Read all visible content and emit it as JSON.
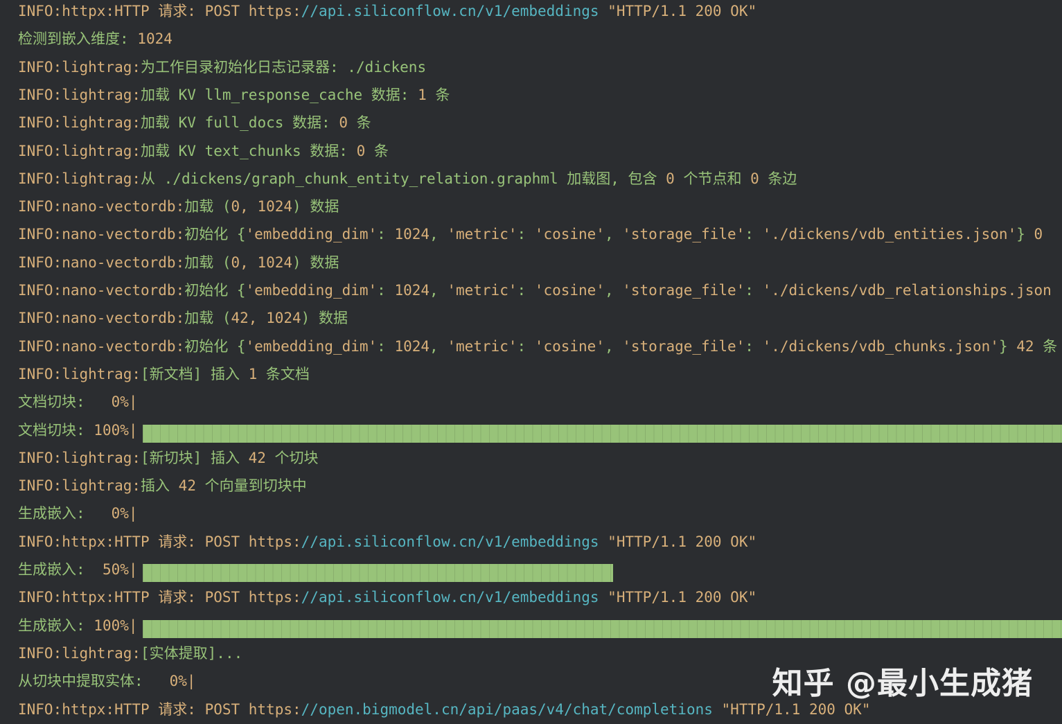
{
  "colors": {
    "background": "#2b2d30",
    "default": "#d8b07a",
    "green": "#98c379",
    "cyan": "#56b6c2",
    "progress": "#98c379",
    "watermark": "#ffffff"
  },
  "log_lines": [
    {
      "segments": [
        {
          "t": "INFO:httpx:HTTP 请求: POST https:",
          "c": "default"
        },
        {
          "t": "//api.siliconflow.cn/v1/embeddings",
          "c": "cyan"
        },
        {
          "t": " \"HTTP/1.1 200 OK\"",
          "c": "default"
        }
      ]
    },
    {
      "segments": [
        {
          "t": "检测到嵌入维度: ",
          "c": "green"
        },
        {
          "t": "1024",
          "c": "default"
        }
      ]
    },
    {
      "segments": [
        {
          "t": "INFO:lightrag:",
          "c": "default"
        },
        {
          "t": "为工作目录初始化日志记录器: ./dickens",
          "c": "green"
        }
      ]
    },
    {
      "segments": [
        {
          "t": "INFO:lightrag:",
          "c": "default"
        },
        {
          "t": "加载 KV llm_response_cache 数据: ",
          "c": "green"
        },
        {
          "t": "1",
          "c": "default"
        },
        {
          "t": " 条",
          "c": "green"
        }
      ]
    },
    {
      "segments": [
        {
          "t": "INFO:lightrag:",
          "c": "default"
        },
        {
          "t": "加载 KV full_docs 数据: ",
          "c": "green"
        },
        {
          "t": "0",
          "c": "default"
        },
        {
          "t": " 条",
          "c": "green"
        }
      ]
    },
    {
      "segments": [
        {
          "t": "INFO:lightrag:",
          "c": "default"
        },
        {
          "t": "加载 KV text_chunks 数据: ",
          "c": "green"
        },
        {
          "t": "0",
          "c": "default"
        },
        {
          "t": " 条",
          "c": "green"
        }
      ]
    },
    {
      "segments": [
        {
          "t": "INFO:lightrag:",
          "c": "default"
        },
        {
          "t": "从 ./dickens/graph_chunk_entity_relation.graphml 加载图, 包含 ",
          "c": "green"
        },
        {
          "t": "0",
          "c": "default"
        },
        {
          "t": " 个节点和 ",
          "c": "green"
        },
        {
          "t": "0",
          "c": "default"
        },
        {
          "t": " 条边",
          "c": "green"
        }
      ]
    },
    {
      "segments": [
        {
          "t": "INFO:nano-vectordb:",
          "c": "default"
        },
        {
          "t": "加载 (",
          "c": "green"
        },
        {
          "t": "0, 1024",
          "c": "default"
        },
        {
          "t": ") 数据",
          "c": "green"
        }
      ]
    },
    {
      "segments": [
        {
          "t": "INFO:nano-vectordb:",
          "c": "default"
        },
        {
          "t": "初始化 {",
          "c": "green"
        },
        {
          "t": "'embedding_dim'",
          "c": "default"
        },
        {
          "t": ": ",
          "c": "green"
        },
        {
          "t": "1024",
          "c": "default"
        },
        {
          "t": ", ",
          "c": "green"
        },
        {
          "t": "'metric'",
          "c": "default"
        },
        {
          "t": ": ",
          "c": "green"
        },
        {
          "t": "'cosine'",
          "c": "default"
        },
        {
          "t": ", ",
          "c": "green"
        },
        {
          "t": "'storage_file'",
          "c": "default"
        },
        {
          "t": ": ",
          "c": "green"
        },
        {
          "t": "'./dickens/vdb_entities.json'",
          "c": "default"
        },
        {
          "t": "} ",
          "c": "green"
        },
        {
          "t": "0",
          "c": "default"
        }
      ]
    },
    {
      "segments": [
        {
          "t": "INFO:nano-vectordb:",
          "c": "default"
        },
        {
          "t": "加载 (",
          "c": "green"
        },
        {
          "t": "0, 1024",
          "c": "default"
        },
        {
          "t": ") 数据",
          "c": "green"
        }
      ]
    },
    {
      "segments": [
        {
          "t": "INFO:nano-vectordb:",
          "c": "default"
        },
        {
          "t": "初始化 {",
          "c": "green"
        },
        {
          "t": "'embedding_dim'",
          "c": "default"
        },
        {
          "t": ": ",
          "c": "green"
        },
        {
          "t": "1024",
          "c": "default"
        },
        {
          "t": ", ",
          "c": "green"
        },
        {
          "t": "'metric'",
          "c": "default"
        },
        {
          "t": ": ",
          "c": "green"
        },
        {
          "t": "'cosine'",
          "c": "default"
        },
        {
          "t": ", ",
          "c": "green"
        },
        {
          "t": "'storage_file'",
          "c": "default"
        },
        {
          "t": ": ",
          "c": "green"
        },
        {
          "t": "'./dickens/vdb_relationships.json",
          "c": "default"
        }
      ]
    },
    {
      "segments": [
        {
          "t": "INFO:nano-vectordb:",
          "c": "default"
        },
        {
          "t": "加载 (",
          "c": "green"
        },
        {
          "t": "42, 1024",
          "c": "default"
        },
        {
          "t": ") 数据",
          "c": "green"
        }
      ]
    },
    {
      "segments": [
        {
          "t": "INFO:nano-vectordb:",
          "c": "default"
        },
        {
          "t": "初始化 {",
          "c": "green"
        },
        {
          "t": "'embedding_dim'",
          "c": "default"
        },
        {
          "t": ": ",
          "c": "green"
        },
        {
          "t": "1024",
          "c": "default"
        },
        {
          "t": ", ",
          "c": "green"
        },
        {
          "t": "'metric'",
          "c": "default"
        },
        {
          "t": ": ",
          "c": "green"
        },
        {
          "t": "'cosine'",
          "c": "default"
        },
        {
          "t": ", ",
          "c": "green"
        },
        {
          "t": "'storage_file'",
          "c": "default"
        },
        {
          "t": ": ",
          "c": "green"
        },
        {
          "t": "'./dickens/vdb_chunks.json'",
          "c": "default"
        },
        {
          "t": "} ",
          "c": "green"
        },
        {
          "t": "42",
          "c": "default"
        },
        {
          "t": " 条",
          "c": "green"
        }
      ]
    },
    {
      "segments": [
        {
          "t": "INFO:lightrag:",
          "c": "default"
        },
        {
          "t": "[新文档] 插入 ",
          "c": "green"
        },
        {
          "t": "1",
          "c": "default"
        },
        {
          "t": " 条文档",
          "c": "green"
        }
      ]
    },
    {
      "segments": [
        {
          "t": "文档切块: ",
          "c": "green"
        },
        {
          "t": "  0%|",
          "c": "default"
        }
      ],
      "progress": 0
    },
    {
      "segments": [
        {
          "t": "文档切块: ",
          "c": "green"
        },
        {
          "t": "100%|",
          "c": "default"
        }
      ],
      "progress": 1
    },
    {
      "segments": [
        {
          "t": "INFO:lightrag:",
          "c": "default"
        },
        {
          "t": "[新切块] 插入 ",
          "c": "green"
        },
        {
          "t": "42",
          "c": "default"
        },
        {
          "t": " 个切块",
          "c": "green"
        }
      ]
    },
    {
      "segments": [
        {
          "t": "INFO:lightrag:",
          "c": "default"
        },
        {
          "t": "插入 ",
          "c": "green"
        },
        {
          "t": "42",
          "c": "default"
        },
        {
          "t": " 个向量到切块中",
          "c": "green"
        }
      ]
    },
    {
      "segments": [
        {
          "t": "生成嵌入: ",
          "c": "green"
        },
        {
          "t": "  0%|",
          "c": "default"
        }
      ],
      "progress": 0
    },
    {
      "segments": [
        {
          "t": "INFO:httpx:HTTP 请求: POST https:",
          "c": "default"
        },
        {
          "t": "//api.siliconflow.cn/v1/embeddings",
          "c": "cyan"
        },
        {
          "t": " \"HTTP/1.1 200 OK\"",
          "c": "default"
        }
      ]
    },
    {
      "segments": [
        {
          "t": "生成嵌入: ",
          "c": "green"
        },
        {
          "t": " 50%|",
          "c": "default"
        }
      ],
      "progress": 0.5
    },
    {
      "segments": [
        {
          "t": "INFO:httpx:HTTP 请求: POST https:",
          "c": "default"
        },
        {
          "t": "//api.siliconflow.cn/v1/embeddings",
          "c": "cyan"
        },
        {
          "t": " \"HTTP/1.1 200 OK\"",
          "c": "default"
        }
      ]
    },
    {
      "segments": [
        {
          "t": "生成嵌入: ",
          "c": "green"
        },
        {
          "t": "100%|",
          "c": "default"
        }
      ],
      "progress": 1
    },
    {
      "segments": [
        {
          "t": "INFO:lightrag:",
          "c": "default"
        },
        {
          "t": "[实体提取]...",
          "c": "green"
        }
      ]
    },
    {
      "segments": [
        {
          "t": "从切块中提取实体: ",
          "c": "green"
        },
        {
          "t": "  0%|",
          "c": "default"
        }
      ],
      "progress": 0
    },
    {
      "segments": [
        {
          "t": "INFO:httpx:HTTP 请求: POST https:",
          "c": "default"
        },
        {
          "t": "//open.bigmodel.cn/api/paas/v4/chat/completions",
          "c": "cyan"
        },
        {
          "t": " \"HTTP/1.1 200 OK\"",
          "c": "default"
        }
      ]
    }
  ],
  "watermark": {
    "text": "知乎 @最小生成猪"
  }
}
